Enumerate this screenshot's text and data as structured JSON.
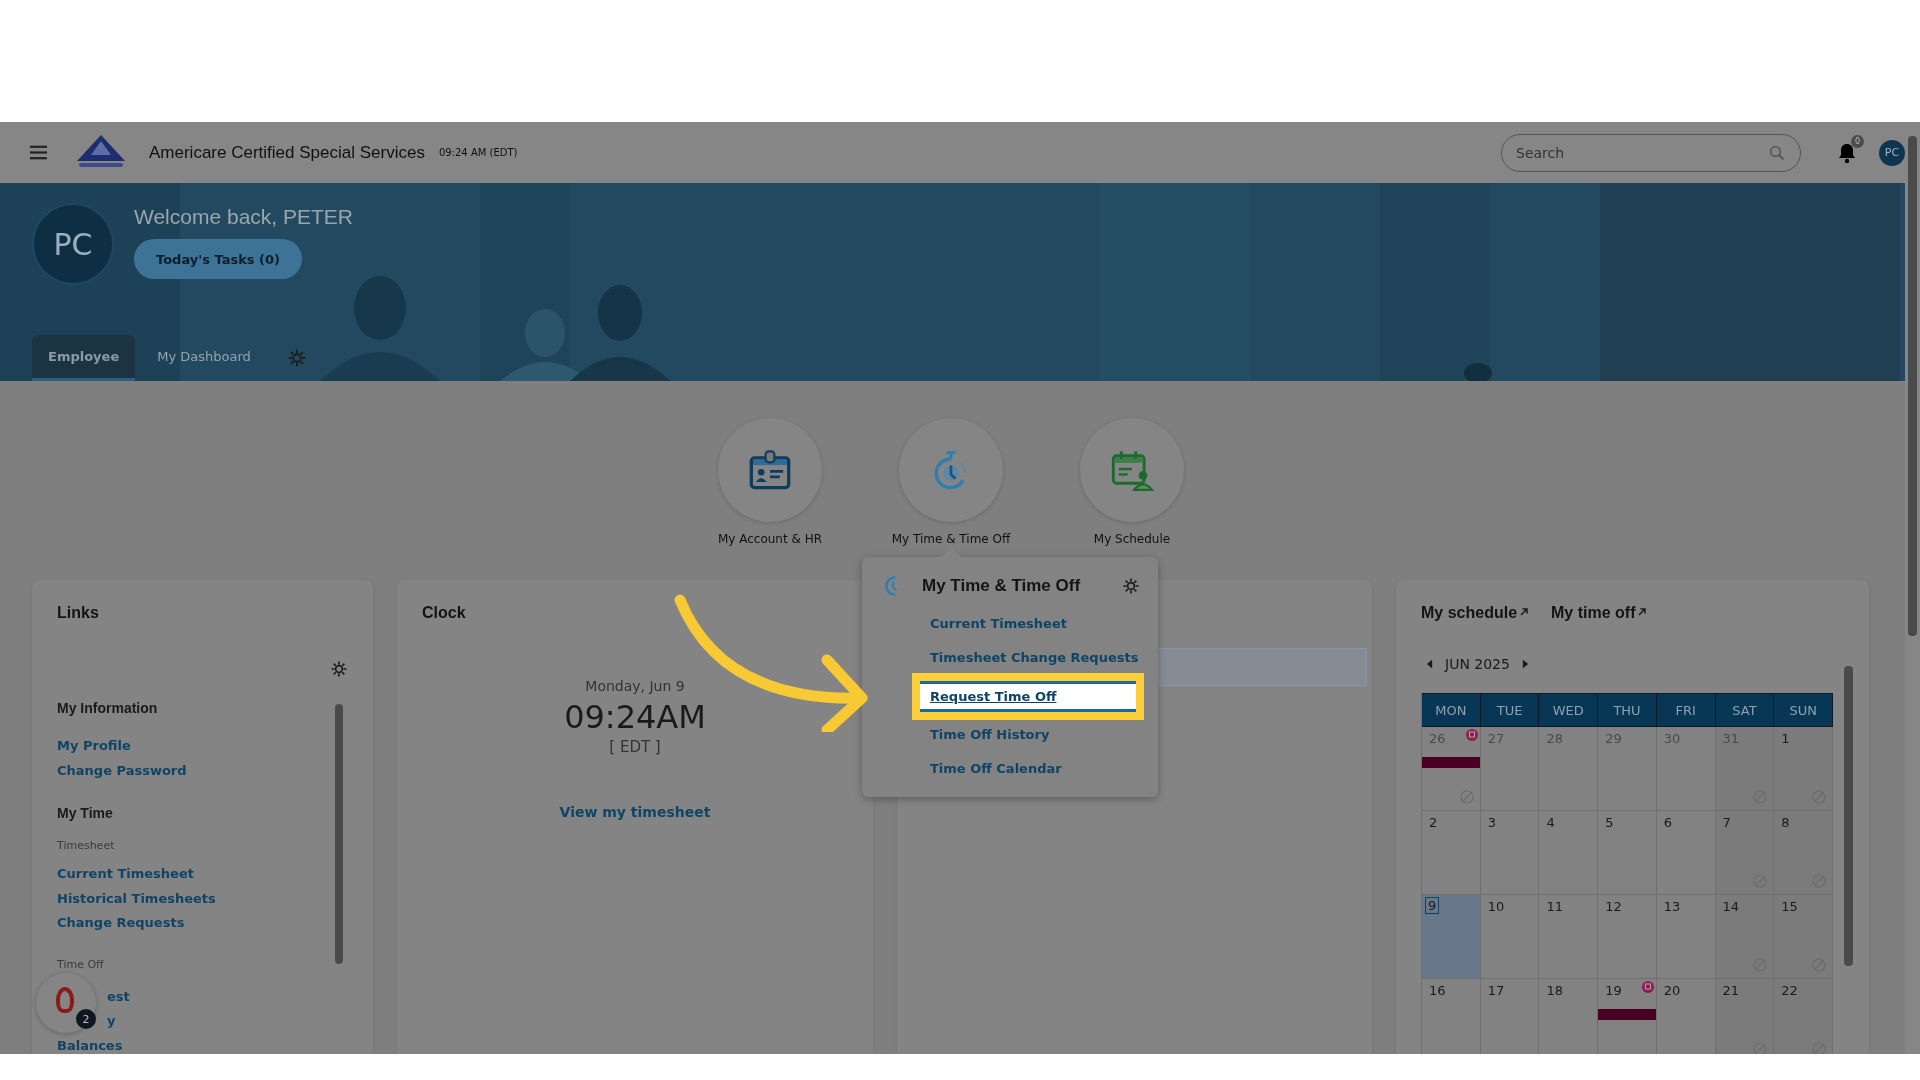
{
  "header": {
    "title": "Americare Certified Special Services",
    "time": "09:24 AM (EDT)",
    "search_placeholder": "Search",
    "notification_count": "0",
    "avatar": "PC"
  },
  "banner": {
    "avatar": "PC",
    "welcome": "Welcome back, PETER",
    "tasks_button": "Today's Tasks (0)",
    "tabs": [
      {
        "label": "Employee",
        "selected": true
      },
      {
        "label": "My Dashboard",
        "selected": false
      }
    ]
  },
  "tiles": [
    {
      "label": "My Account & HR",
      "kind": "account"
    },
    {
      "label": "My Time & Time Off",
      "kind": "time"
    },
    {
      "label": "My Schedule",
      "kind": "schedule"
    }
  ],
  "popup": {
    "title": "My Time & Time Off",
    "items": [
      {
        "label": "Current Timesheet",
        "highlighted": false
      },
      {
        "label": "Timesheet Change Requests",
        "highlighted": false
      },
      {
        "label": "Request Time Off",
        "highlighted": true
      },
      {
        "label": "Time Off History",
        "highlighted": false
      },
      {
        "label": "Time Off Calendar",
        "highlighted": false
      }
    ]
  },
  "links": {
    "title": "Links",
    "sections": [
      {
        "heading": "My Information",
        "groups": [
          {
            "items": [
              {
                "label": "My Profile"
              },
              {
                "label": "Change Password"
              }
            ]
          }
        ]
      },
      {
        "heading": "My Time",
        "groups": [
          {
            "subheading": "Timesheet",
            "items": [
              {
                "label": "Current Timesheet"
              },
              {
                "label": "Historical Timesheets"
              },
              {
                "label": "Change Requests"
              }
            ]
          },
          {
            "subheading": "Time Off",
            "items": [
              {
                "label": "est"
              },
              {
                "label": "y"
              },
              {
                "label": "Balances"
              }
            ]
          }
        ]
      }
    ]
  },
  "clock": {
    "title": "Clock",
    "date": "Monday, Jun 9",
    "time": "09:24AM",
    "zone": "[ EDT ]",
    "link": "View my timesheet"
  },
  "schedule": {
    "tabs": [
      "My schedule",
      "My time off"
    ],
    "month": "JUN 2025",
    "weekdays": [
      "MON",
      "TUE",
      "WED",
      "THU",
      "FRI",
      "SAT",
      "SUN"
    ],
    "weeks": [
      [
        {
          "day": "26",
          "outside": true,
          "today": false,
          "event": true,
          "unavailable": true
        },
        {
          "day": "27",
          "outside": true,
          "today": false,
          "event": false,
          "unavailable": false
        },
        {
          "day": "28",
          "outside": true,
          "today": false,
          "event": false,
          "unavailable": false
        },
        {
          "day": "29",
          "outside": true,
          "today": false,
          "event": false,
          "unavailable": false
        },
        {
          "day": "30",
          "outside": true,
          "today": false,
          "event": false,
          "unavailable": false
        },
        {
          "day": "31",
          "outside": true,
          "today": false,
          "event": false,
          "unavailable": true
        },
        {
          "day": "1",
          "outside": false,
          "today": false,
          "event": false,
          "unavailable": true
        }
      ],
      [
        {
          "day": "2",
          "outside": false,
          "today": false,
          "event": false,
          "unavailable": false
        },
        {
          "day": "3",
          "outside": false,
          "today": false,
          "event": false,
          "unavailable": false
        },
        {
          "day": "4",
          "outside": false,
          "today": false,
          "event": false,
          "unavailable": false
        },
        {
          "day": "5",
          "outside": false,
          "today": false,
          "event": false,
          "unavailable": false
        },
        {
          "day": "6",
          "outside": false,
          "today": false,
          "event": false,
          "unavailable": false
        },
        {
          "day": "7",
          "outside": false,
          "today": false,
          "event": false,
          "unavailable": true
        },
        {
          "day": "8",
          "outside": false,
          "today": false,
          "event": false,
          "unavailable": true
        }
      ],
      [
        {
          "day": "9",
          "outside": false,
          "today": true,
          "event": false,
          "unavailable": false
        },
        {
          "day": "10",
          "outside": false,
          "today": false,
          "event": false,
          "unavailable": false
        },
        {
          "day": "11",
          "outside": false,
          "today": false,
          "event": false,
          "unavailable": false
        },
        {
          "day": "12",
          "outside": false,
          "today": false,
          "event": false,
          "unavailable": false
        },
        {
          "day": "13",
          "outside": false,
          "today": false,
          "event": false,
          "unavailable": false
        },
        {
          "day": "14",
          "outside": false,
          "today": false,
          "event": false,
          "unavailable": true
        },
        {
          "day": "15",
          "outside": false,
          "today": false,
          "event": false,
          "unavailable": true
        }
      ],
      [
        {
          "day": "16",
          "outside": false,
          "today": false,
          "event": false,
          "unavailable": false
        },
        {
          "day": "17",
          "outside": false,
          "today": false,
          "event": false,
          "unavailable": false
        },
        {
          "day": "18",
          "outside": false,
          "today": false,
          "event": false,
          "unavailable": false
        },
        {
          "day": "19",
          "outside": false,
          "today": false,
          "event": true,
          "unavailable": false
        },
        {
          "day": "20",
          "outside": false,
          "today": false,
          "event": false,
          "unavailable": false
        },
        {
          "day": "21",
          "outside": false,
          "today": false,
          "event": false,
          "unavailable": true
        },
        {
          "day": "22",
          "outside": false,
          "today": false,
          "event": false,
          "unavailable": true
        }
      ]
    ]
  },
  "chat_widget": {
    "badge": "2"
  }
}
